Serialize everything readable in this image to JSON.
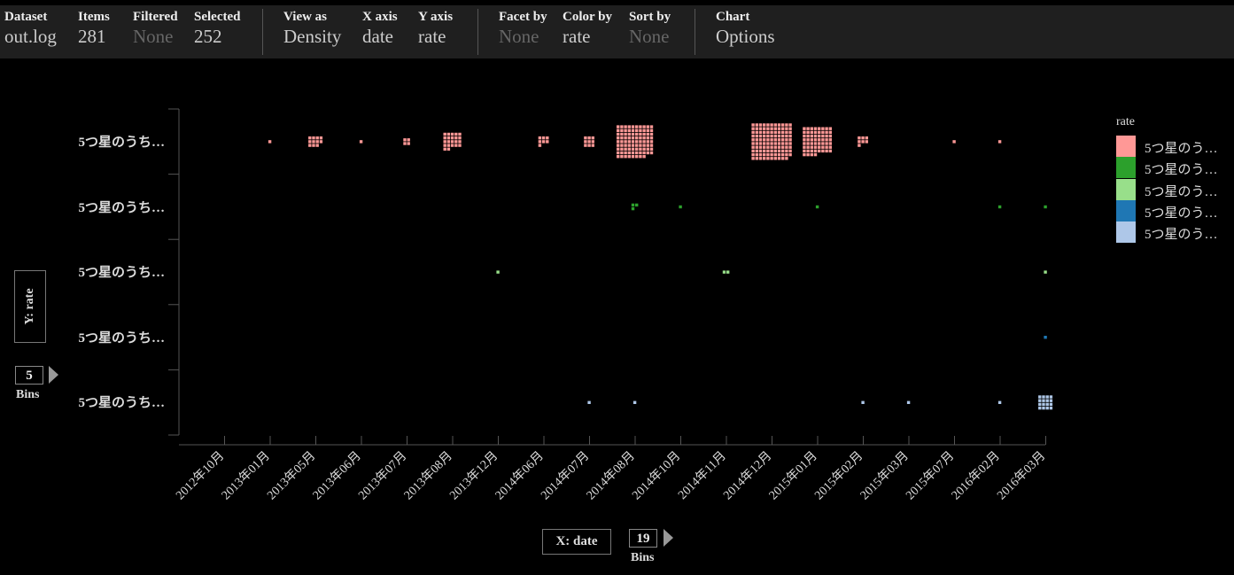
{
  "topbar": {
    "dataset": {
      "label": "Dataset",
      "value": "out.log"
    },
    "items": {
      "label": "Items",
      "value": "281"
    },
    "filtered": {
      "label": "Filtered",
      "value": "None"
    },
    "selected": {
      "label": "Selected",
      "value": "252"
    },
    "view_as": {
      "label": "View as",
      "value": "Density"
    },
    "x_axis": {
      "label": "X axis",
      "value": "date"
    },
    "y_axis": {
      "label": "Y axis",
      "value": "rate"
    },
    "facet_by": {
      "label": "Facet by",
      "value": "None"
    },
    "color_by": {
      "label": "Color by",
      "value": "rate"
    },
    "sort_by": {
      "label": "Sort by",
      "value": "None"
    },
    "chart": {
      "label": "Chart",
      "value": "Options"
    }
  },
  "axis_controls": {
    "y_label": "Y: rate",
    "y_bins": "5",
    "y_bins_label": "Bins",
    "x_label": "X: date",
    "x_bins": "19",
    "x_bins_label": "Bins"
  },
  "legend": {
    "title": "rate",
    "items": [
      {
        "label": "5つ星のう…",
        "color": "#ff9896"
      },
      {
        "label": "5つ星のう…",
        "color": "#2ca02c"
      },
      {
        "label": "5つ星のう…",
        "color": "#98df8a"
      },
      {
        "label": "5つ星のう…",
        "color": "#1f77b4"
      },
      {
        "label": "5つ星のう…",
        "color": "#aec7e8"
      }
    ]
  },
  "chart_data": {
    "type": "heatmap",
    "xlabel": "X: date",
    "ylabel": "Y: rate",
    "x_categories": [
      "2012年10月",
      "2013年01月",
      "2013年05月",
      "2013年06月",
      "2013年07月",
      "2013年08月",
      "2013年12月",
      "2014年06月",
      "2014年07月",
      "2014年08月",
      "2014年10月",
      "2014年11月",
      "2014年12月",
      "2015年01月",
      "2015年02月",
      "2015年03月",
      "2015年07月",
      "2016年02月",
      "2016年03月"
    ],
    "y_categories": [
      "5つ星のうち…",
      "5つ星のうち…",
      "5つ星のうち…",
      "5つ星のうち…",
      "5つ星のうち…"
    ],
    "series": [
      {
        "row": 0,
        "color": "#ff9896",
        "counts": [
          0,
          1,
          11,
          1,
          4,
          22,
          0,
          7,
          9,
          88,
          0,
          0,
          109,
          60,
          7,
          0,
          1,
          1,
          0
        ]
      },
      {
        "row": 1,
        "color": "#2ca02c",
        "counts": [
          0,
          0,
          0,
          0,
          0,
          0,
          0,
          0,
          0,
          3,
          1,
          0,
          0,
          1,
          0,
          0,
          0,
          1,
          1
        ]
      },
      {
        "row": 2,
        "color": "#98df8a",
        "counts": [
          0,
          0,
          0,
          0,
          0,
          0,
          1,
          0,
          0,
          0,
          0,
          2,
          0,
          0,
          0,
          0,
          0,
          0,
          1
        ]
      },
      {
        "row": 3,
        "color": "#1f77b4",
        "counts": [
          0,
          0,
          0,
          0,
          0,
          0,
          0,
          0,
          0,
          0,
          0,
          0,
          0,
          0,
          0,
          0,
          0,
          0,
          1
        ]
      },
      {
        "row": 4,
        "color": "#aec7e8",
        "counts": [
          0,
          0,
          0,
          0,
          0,
          0,
          0,
          0,
          1,
          1,
          0,
          0,
          0,
          0,
          1,
          1,
          0,
          1,
          16
        ]
      }
    ]
  }
}
